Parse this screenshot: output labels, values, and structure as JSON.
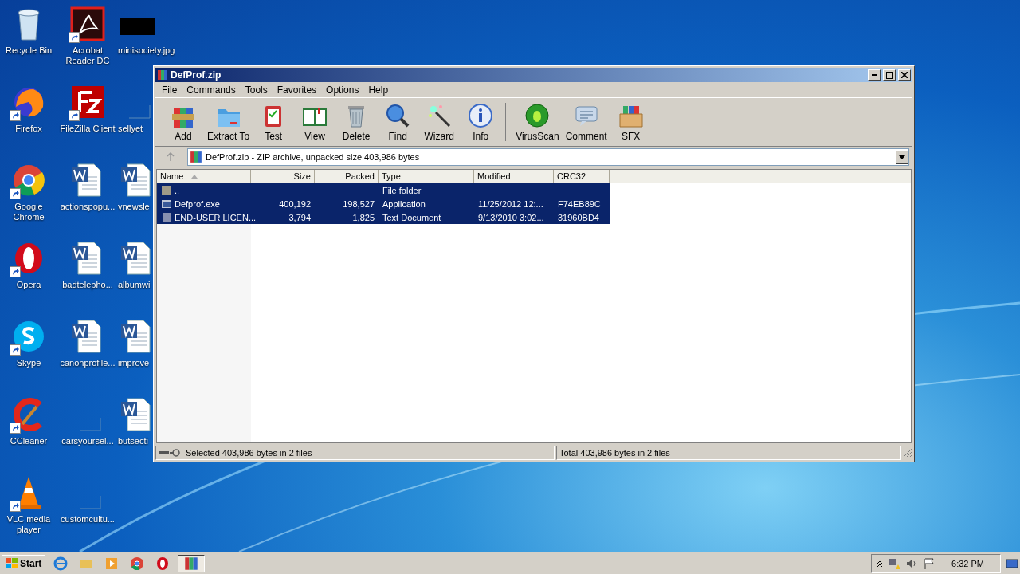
{
  "desktop": {
    "columns": [
      [
        {
          "label": "Recycle Bin",
          "kind": "system"
        },
        {
          "label": "Firefox",
          "kind": "shortcut"
        },
        {
          "label": "Google Chrome",
          "kind": "shortcut"
        },
        {
          "label": "Opera",
          "kind": "shortcut"
        },
        {
          "label": "Skype",
          "kind": "shortcut"
        },
        {
          "label": "CCleaner",
          "kind": "shortcut"
        },
        {
          "label": "VLC media player",
          "kind": "shortcut"
        }
      ],
      [
        {
          "label": "Acrobat Reader DC",
          "kind": "shortcut"
        },
        {
          "label": "FileZilla Client",
          "kind": "shortcut"
        },
        {
          "label": "actionspopu...",
          "kind": "document"
        },
        {
          "label": "badtelepho...",
          "kind": "document"
        },
        {
          "label": "canonprofile...",
          "kind": "document"
        },
        {
          "label": "carsyoursel...",
          "kind": "blank"
        },
        {
          "label": "customcultu...",
          "kind": "blank"
        }
      ],
      [
        {
          "label": "minisociety.jpg",
          "kind": "image"
        },
        {
          "label": "sellyet",
          "kind": "blank"
        },
        {
          "label": "vnewsle",
          "kind": "document"
        },
        {
          "label": "albumwi",
          "kind": "document"
        },
        {
          "label": "improve",
          "kind": "document"
        },
        {
          "label": "butsecti",
          "kind": "document"
        }
      ]
    ]
  },
  "window": {
    "title": "DefProf.zip",
    "menu": [
      "File",
      "Commands",
      "Tools",
      "Favorites",
      "Options",
      "Help"
    ],
    "toolbar": [
      {
        "label": "Add"
      },
      {
        "label": "Extract To"
      },
      {
        "label": "Test"
      },
      {
        "label": "View"
      },
      {
        "label": "Delete"
      },
      {
        "label": "Find"
      },
      {
        "label": "Wizard"
      },
      {
        "label": "Info"
      },
      {
        "label": "VirusScan"
      },
      {
        "label": "Comment"
      },
      {
        "label": "SFX"
      }
    ],
    "address": "DefProf.zip - ZIP archive, unpacked size 403,986 bytes",
    "columns": [
      {
        "label": "Name",
        "sorted": true
      },
      {
        "label": "Size",
        "sorted": false
      },
      {
        "label": "Packed",
        "sorted": false
      },
      {
        "label": "Type",
        "sorted": false
      },
      {
        "label": "Modified",
        "sorted": false
      },
      {
        "label": "CRC32",
        "sorted": false
      }
    ],
    "rows": [
      {
        "kind": "parent",
        "cells": [
          "..",
          "",
          "",
          "File folder",
          "",
          ""
        ],
        "selected": true
      },
      {
        "kind": "exe",
        "cells": [
          "Defprof.exe",
          "400,192",
          "198,527",
          "Application",
          "11/25/2012 12:...",
          "F74EB89C"
        ],
        "selected": true
      },
      {
        "kind": "text",
        "cells": [
          "END-USER LICEN...",
          "3,794",
          "1,825",
          "Text Document",
          "9/13/2010 3:02...",
          "31960BD4"
        ],
        "selected": true
      }
    ],
    "status_bar": [
      "Selected 403,986 bytes in 2 files",
      "Total 403,986 bytes in 2 files"
    ]
  },
  "taskbar": {
    "start": "Start",
    "tasks": [
      {
        "selected": true
      }
    ],
    "clock": "6:32 PM"
  }
}
